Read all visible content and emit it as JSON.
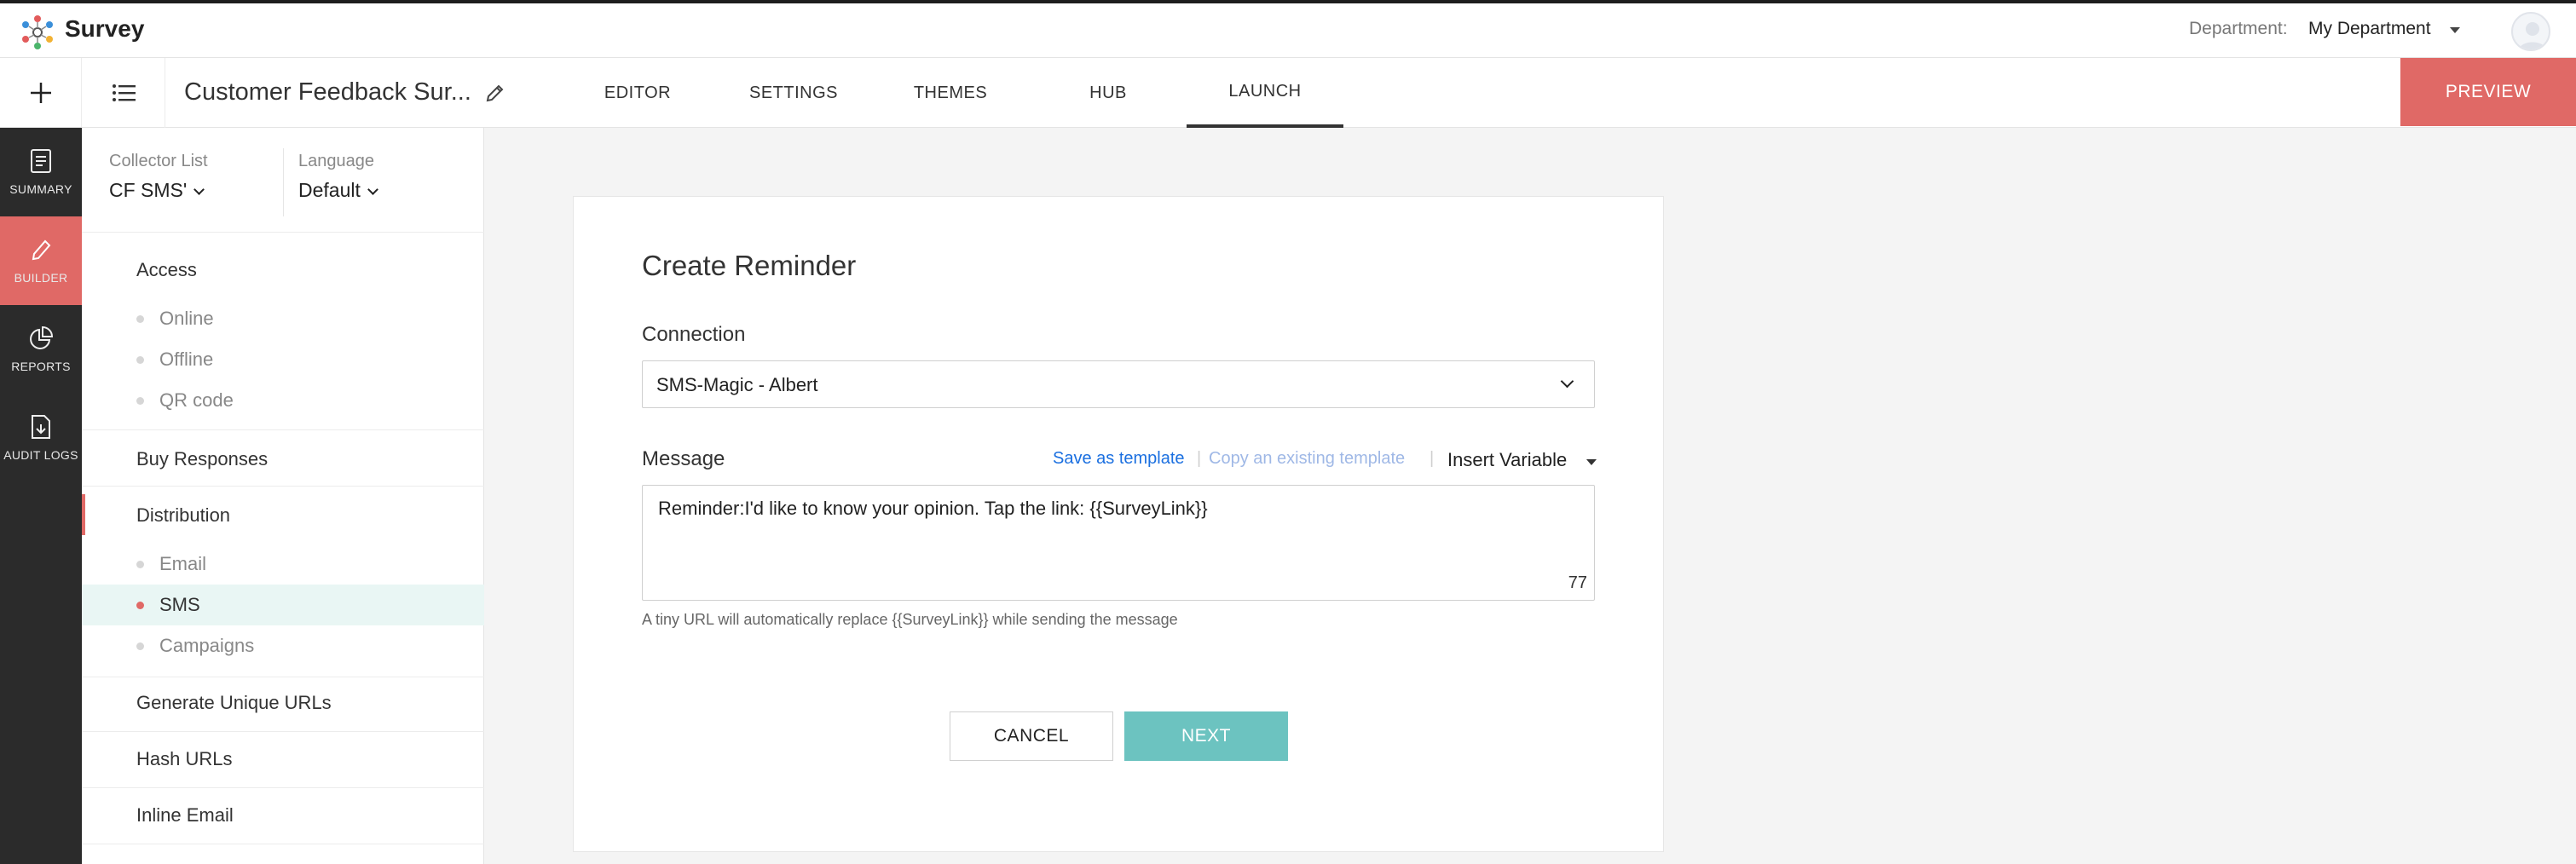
{
  "header": {
    "app_name": "Survey",
    "department_label": "Department:",
    "department_value": "My Department"
  },
  "toolbar": {
    "survey_title": "Customer Feedback Sur...",
    "tabs": [
      {
        "label": "EDITOR"
      },
      {
        "label": "SETTINGS"
      },
      {
        "label": "THEMES"
      },
      {
        "label": "HUB"
      },
      {
        "label": "LAUNCH",
        "active": true
      }
    ],
    "preview_label": "PREVIEW"
  },
  "leftnav": {
    "items": [
      {
        "label": "SUMMARY",
        "icon": "document-icon"
      },
      {
        "label": "BUILDER",
        "icon": "pencil-icon",
        "active": true
      },
      {
        "label": "REPORTS",
        "icon": "pie-chart-icon"
      },
      {
        "label": "AUDIT LOGS",
        "icon": "log-file-icon"
      }
    ]
  },
  "panel": {
    "collector_label": "Collector List",
    "collector_value": "CF SMS'",
    "language_label": "Language",
    "language_value": "Default",
    "access": "Access",
    "access_items": [
      "Online",
      "Offline",
      "QR code"
    ],
    "buy_responses": "Buy Responses",
    "distribution": "Distribution",
    "distribution_items": [
      "Email",
      "SMS",
      "Campaigns"
    ],
    "active_item": "SMS",
    "generate_urls": "Generate Unique URLs",
    "hash_urls": "Hash URLs",
    "inline_email": "Inline Email"
  },
  "form": {
    "title": "Create Reminder",
    "connection_label": "Connection",
    "connection_value": "SMS-Magic - Albert",
    "message_label": "Message",
    "save_template": "Save as template",
    "separator": "|",
    "copy_template": "Copy an existing template",
    "insert_variable": "Insert Variable",
    "message_text": "Reminder:I'd like to know your opinion. Tap the link: {{SurveyLink}}",
    "char_count": "77",
    "hint": "A tiny URL will automatically replace {{SurveyLink}} while sending the message",
    "cancel_label": "CANCEL",
    "next_label": "NEXT"
  },
  "colors": {
    "accent": "#e06966",
    "next_button": "#6cc3c0",
    "link": "#1a6fe0",
    "sidebar": "#2b2b2b"
  }
}
